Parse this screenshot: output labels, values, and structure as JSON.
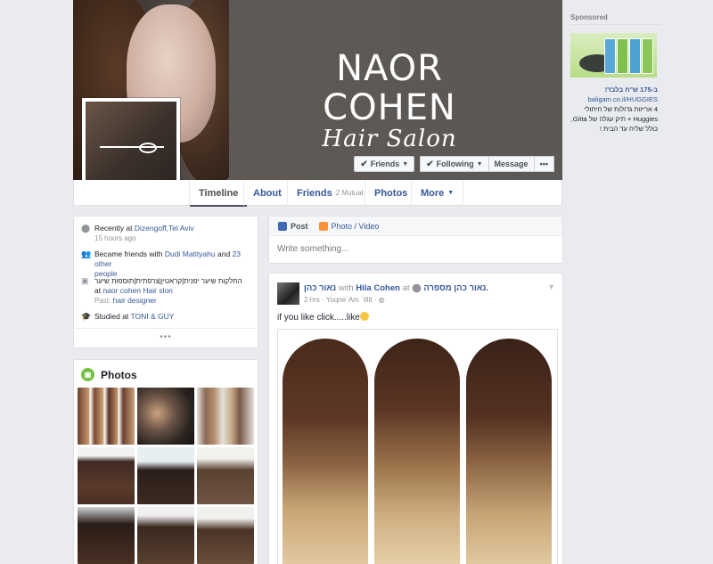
{
  "cover": {
    "brand_title": "NAOR COHEN",
    "brand_subtitle": "Hair Salon",
    "actions": {
      "friends": "Friends",
      "following": "Following",
      "message": "Message",
      "more": "•••"
    }
  },
  "tabs": [
    {
      "label": "Timeline"
    },
    {
      "label": "About"
    },
    {
      "label": "Friends",
      "count": "2 Mutual"
    },
    {
      "label": "Photos"
    },
    {
      "label": "More"
    }
  ],
  "intro": {
    "location_prefix": "Recently at",
    "location": "Dizengoff,Tel Aviv",
    "location_time": "15 hours ago",
    "friends_prefix": "Became friends with",
    "friend_name": "Dudi Matityahu",
    "friends_and": "and",
    "friends_others": "23 other",
    "friends_others2": "people",
    "work_title": "החלקות שיער יפנית|קראטין|צרפתית|תוספות שיער",
    "work_at": "at",
    "work_place": "naor cohen Hair slon",
    "past_prefix": "Past:",
    "past_role": "hair designer",
    "studied_prefix": "Studied at",
    "school": "TONI & GUY",
    "more": "•••"
  },
  "photos": {
    "title": "Photos"
  },
  "composer": {
    "post_tab": "Post",
    "photo_tab": "Photo / Video",
    "placeholder": "Write something..."
  },
  "post": {
    "author": "נאור כהן",
    "with_text": "with",
    "tagged": "Hila Cohen",
    "at_text": "at",
    "place": "נאור כהן מספרה.",
    "time": "2 hrs",
    "location": "Yoqne`Am `Illit",
    "text": "if you like click.....like"
  },
  "sidebar": {
    "sponsored": "Sponsored",
    "ad_title": "ב-175 ש\"ח בלבד!",
    "ad_line1": "4 אריזות גדולות של חיתולי",
    "ad_line2": "Huggies + תיק עגלה של Gitta,",
    "ad_line3": "כולל שליח עד הבית !",
    "ad_link": "baligam.co.il/HUGGIES"
  },
  "colors": {
    "link": "#365899",
    "background": "#e9ebee",
    "photos_icon": "#75c044"
  }
}
